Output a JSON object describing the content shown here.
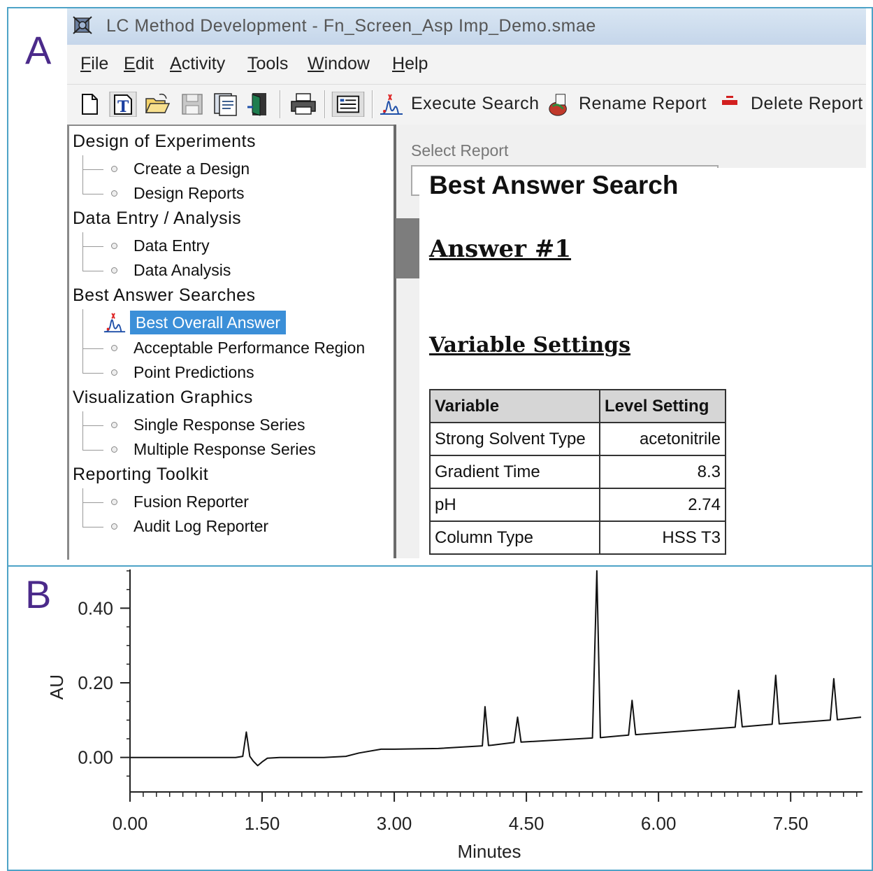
{
  "panels": {
    "a": "A",
    "b": "B"
  },
  "window": {
    "title": "LC Method Development - Fn_Screen_Asp Imp_Demo.smae"
  },
  "menu": [
    "File",
    "Edit",
    "Activity",
    "Tools",
    "Window",
    "Help"
  ],
  "toolbar": {
    "execute_search": "Execute Search",
    "rename_report": "Rename Report",
    "delete_report": "Delete Report"
  },
  "tree": {
    "groups": [
      {
        "label": "Design of Experiments",
        "items": [
          "Create a Design",
          "Design Reports"
        ]
      },
      {
        "label": "Data Entry / Analysis",
        "items": [
          "Data Entry",
          "Data Analysis"
        ]
      },
      {
        "label": "Best Answer Searches",
        "items": [
          "Best Overall Answer",
          "Acceptable Performance Region",
          "Point Predictions"
        ]
      },
      {
        "label": "Visualization Graphics",
        "items": [
          "Single Response Series",
          "Multiple Response Series"
        ]
      },
      {
        "label": "Reporting Toolkit",
        "items": [
          "Fusion Reporter",
          "Audit Log Reporter"
        ]
      }
    ],
    "selected": "Best Overall Answer"
  },
  "report": {
    "select_label": "Select Report",
    "title": "Best Answer Search",
    "answer_heading": "Answer #1",
    "variables_heading": "Variable Settings",
    "table": {
      "headers": [
        "Variable",
        "Level Setting"
      ],
      "rows": [
        [
          "Strong Solvent Type",
          "acetonitrile"
        ],
        [
          "Gradient Time",
          "8.3"
        ],
        [
          "pH",
          "2.74"
        ],
        [
          "Column Type",
          "HSS T3"
        ]
      ]
    }
  },
  "chart_data": {
    "type": "line",
    "xlabel": "Minutes",
    "ylabel": "AU",
    "xlim": [
      0.0,
      8.3
    ],
    "ylim": [
      -0.07,
      0.5
    ],
    "x_ticks": [
      "0.00",
      "1.50",
      "3.00",
      "4.50",
      "6.00",
      "7.50"
    ],
    "x_tick_values": [
      0.0,
      1.5,
      3.0,
      4.5,
      6.0,
      7.5
    ],
    "y_ticks": [
      "0.00",
      "0.20",
      "0.40"
    ],
    "y_tick_values": [
      0.0,
      0.2,
      0.4
    ],
    "series": [
      {
        "x": [
          0.0,
          1.2,
          1.28,
          1.32,
          1.36,
          1.4,
          1.45,
          1.5,
          1.56,
          1.7,
          2.2,
          2.45,
          2.6,
          2.85,
          3.0,
          3.5,
          4.0,
          4.03,
          4.07,
          4.11,
          4.36,
          4.4,
          4.44,
          5.25,
          5.3,
          5.34,
          5.38,
          5.66,
          5.7,
          5.74,
          6.87,
          6.91,
          6.95,
          7.29,
          7.33,
          7.37,
          7.95,
          7.99,
          8.03,
          8.3
        ],
        "y": [
          0.0,
          0.0,
          0.003,
          0.068,
          0.003,
          -0.01,
          -0.022,
          -0.012,
          -0.002,
          0.0,
          0.0,
          0.003,
          0.012,
          0.022,
          0.022,
          0.024,
          0.031,
          0.136,
          0.032,
          0.033,
          0.04,
          0.108,
          0.041,
          0.052,
          0.5,
          0.053,
          0.054,
          0.06,
          0.153,
          0.061,
          0.081,
          0.18,
          0.082,
          0.089,
          0.22,
          0.09,
          0.1,
          0.211,
          0.101,
          0.108
        ]
      }
    ]
  }
}
